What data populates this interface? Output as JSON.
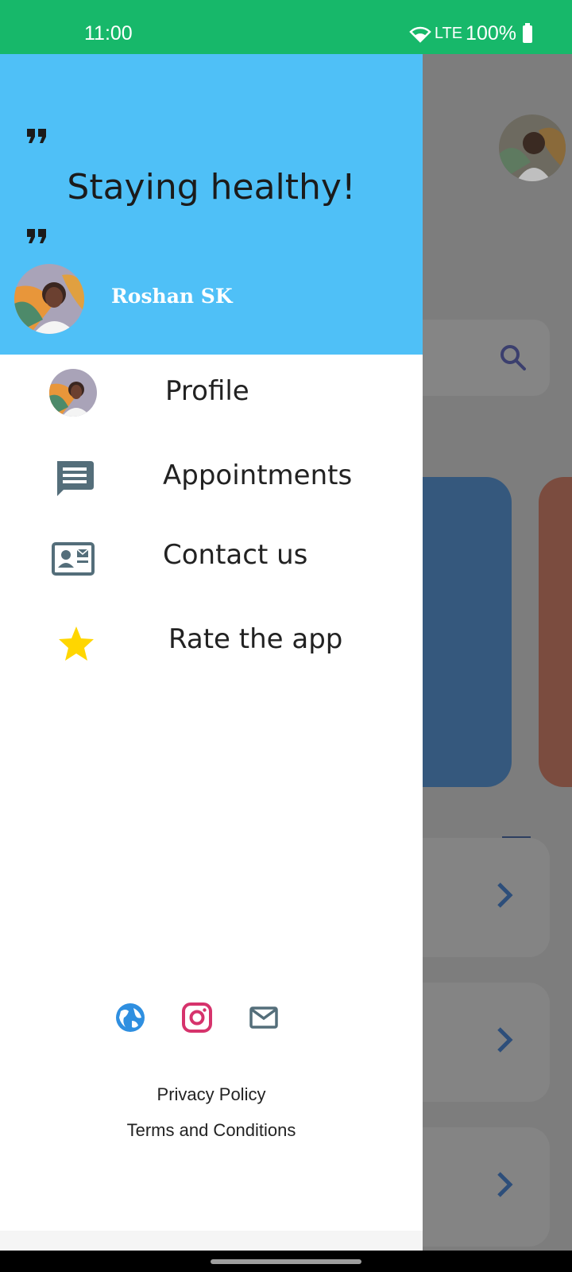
{
  "status_bar": {
    "time": "11:00",
    "network": "LTE",
    "battery": "100%"
  },
  "drawer": {
    "header": {
      "quote": "Staying healthy!",
      "user_name": "Roshan SK"
    },
    "menu": [
      {
        "label": "Profile",
        "icon": "avatar-icon"
      },
      {
        "label": "Appointments",
        "icon": "message-icon"
      },
      {
        "label": "Contact us",
        "icon": "contact-card-icon"
      },
      {
        "label": "Rate the app",
        "icon": "star-icon"
      }
    ],
    "social_icons": [
      "globe-icon",
      "instagram-icon",
      "mail-icon"
    ],
    "footer": {
      "privacy": "Privacy Policy",
      "terms": "Terms and Conditions"
    }
  },
  "colors": {
    "status_bar": "#17b86a",
    "header": "#4fc0f7",
    "star": "#ffd600",
    "instagram": "#d6336c",
    "globe": "#2f8fe0",
    "icon_gray": "#546e7a"
  }
}
